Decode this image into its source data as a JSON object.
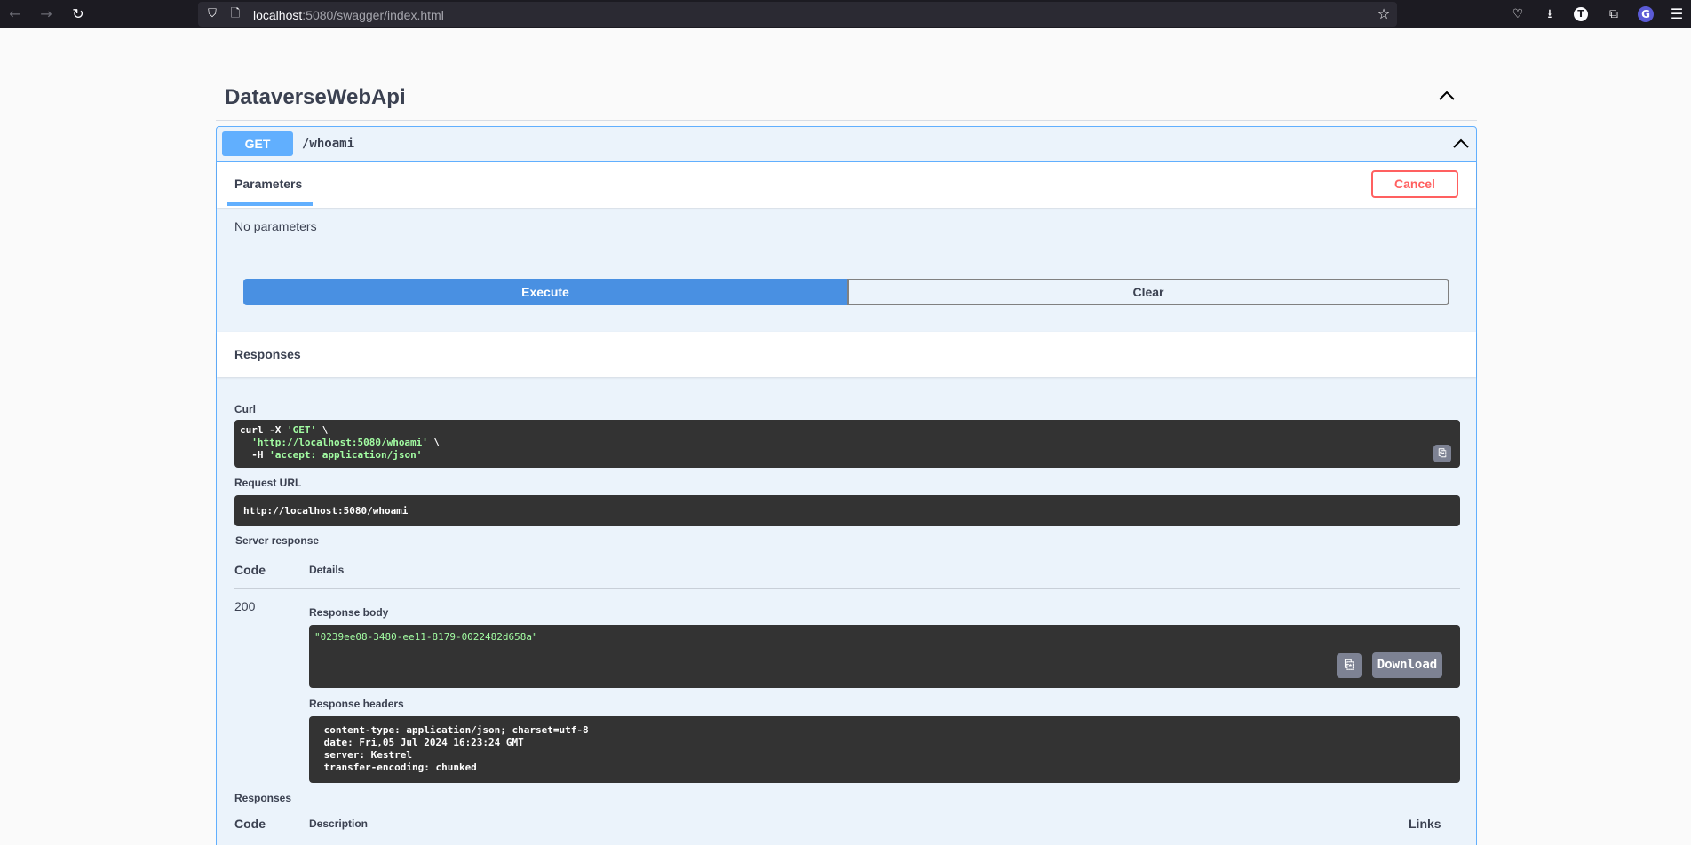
{
  "browser": {
    "url_host": "localhost",
    "url_rest": ":5080/swagger/index.html",
    "avatar_letter": "T",
    "extension_letter": "G"
  },
  "api": {
    "title": "DataverseWebApi"
  },
  "operation": {
    "method": "GET",
    "path": "/whoami",
    "parameters_tab": "Parameters",
    "cancel_label": "Cancel",
    "no_parameters": "No parameters",
    "execute_label": "Execute",
    "clear_label": "Clear",
    "responses_title": "Responses"
  },
  "live_response": {
    "curl_label": "Curl",
    "curl_lines": [
      [
        "curl -X ",
        "'GET'",
        " \\"
      ],
      [
        "  ",
        "'http://localhost:5080/whoami'",
        " \\"
      ],
      [
        "  -H ",
        "'accept: application/json'",
        ""
      ]
    ],
    "request_url_label": "Request URL",
    "request_url": "http://localhost:5080/whoami",
    "server_response_label": "Server response",
    "code_header": "Code",
    "details_header": "Details",
    "status_code": "200",
    "response_body_label": "Response body",
    "response_body": "\"0239ee08-3480-ee11-8179-0022482d658a\"",
    "download_label": "Download",
    "response_headers_label": "Response headers",
    "response_headers": [
      " content-type: application/json; charset=utf-8 ",
      " date: Fri,05 Jul 2024 16:23:24 GMT ",
      " server: Kestrel ",
      " transfer-encoding: chunked "
    ]
  },
  "documented_responses": {
    "label": "Responses",
    "code_header": "Code",
    "description_header": "Description",
    "links_header": "Links"
  },
  "colors": {
    "get_accent": "#61affe",
    "execute_blue": "#4990e2",
    "cancel_red": "#ff6060",
    "code_bg": "#333333",
    "string_green": "#a2fca2"
  }
}
